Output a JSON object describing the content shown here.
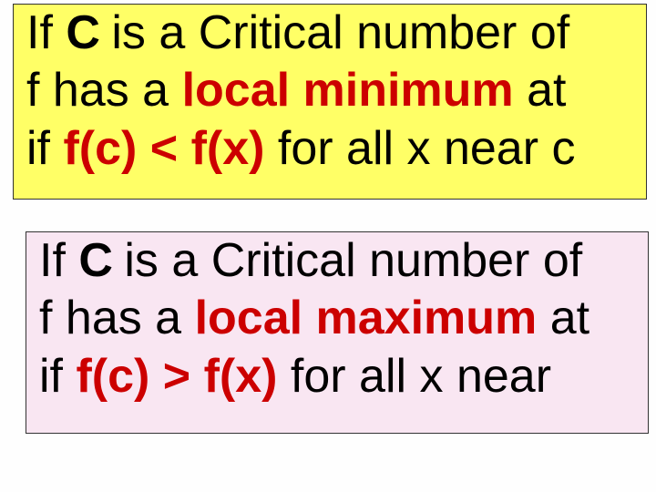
{
  "minimum_box": {
    "line1_a": "If  ",
    "line1_c": "C",
    "line1_b": " is a Critical number of",
    "line2_a": "f has a ",
    "line2_red": "local minimum",
    "line2_b": " at",
    "line3_a": "if  ",
    "line3_red": "f(c) < f(x)",
    "line3_b": " for all x near c"
  },
  "maximum_box": {
    "line1_a": "If  ",
    "line1_c": "C",
    "line1_b": " is a Critical number of",
    "line2_a": "f has a ",
    "line2_red": "local maximum",
    "line2_b": " at",
    "line3_a": "if  ",
    "line3_red": "f(c) > f(x)",
    "line3_b": " for all x near "
  }
}
